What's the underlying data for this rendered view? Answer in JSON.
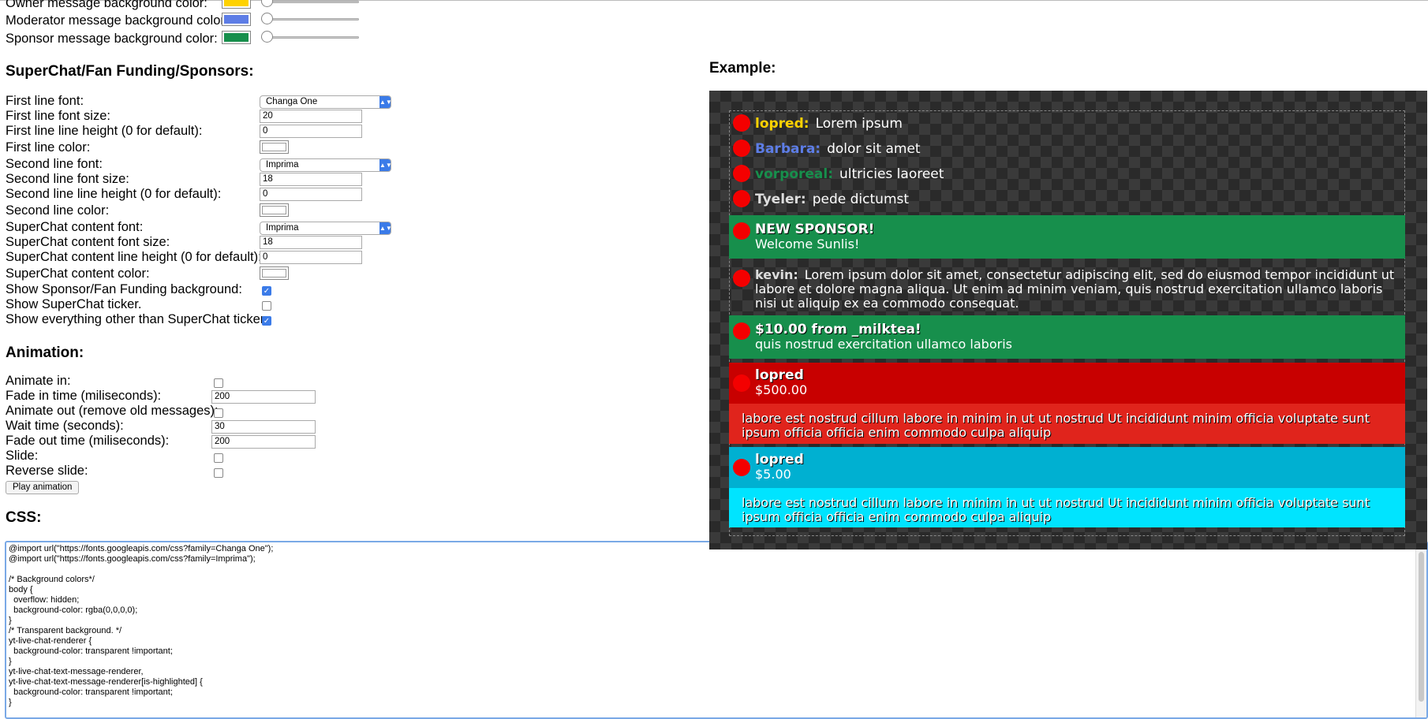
{
  "colors": {
    "owner_bg": "#ffd200",
    "moderator_bg": "#5d7de6",
    "sponsor_bg": "#178f4c",
    "accent": "#3b7be8",
    "superchat_red_head": "#c80000",
    "superchat_red_body": "#e0241c",
    "superchat_blue_head": "#00b0d1",
    "superchat_blue_body": "#00e4ff"
  },
  "top_settings": [
    {
      "label": "Owner message background color:",
      "color": "#ffd200"
    },
    {
      "label": "Moderator message background color:",
      "color": "#5d7de6"
    },
    {
      "label": "Sponsor message background color:",
      "color": "#178f4c"
    }
  ],
  "superchat_section": {
    "heading": "SuperChat/Fan Funding/Sponsors:",
    "first_line_font_label": "First line font:",
    "first_line_font_value": "Changa One",
    "first_line_font_size_label": "First line font size:",
    "first_line_font_size_value": "20",
    "first_line_line_height_label": "First line line height (0 for default):",
    "first_line_line_height_value": "0",
    "first_line_color_label": "First line color:",
    "second_line_font_label": "Second line font:",
    "second_line_font_value": "Imprima",
    "second_line_font_size_label": "Second line font size:",
    "second_line_font_size_value": "18",
    "second_line_line_height_label": "Second line line height (0 for default):",
    "second_line_line_height_value": "0",
    "second_line_color_label": "Second line color:",
    "content_font_label": "SuperChat content font:",
    "content_font_value": "Imprima",
    "content_font_size_label": "SuperChat content font size:",
    "content_font_size_value": "18",
    "content_line_height_label": "SuperChat content line height (0 for default):",
    "content_line_height_value": "0",
    "content_color_label": "SuperChat content color:",
    "show_bg_label": "Show Sponsor/Fan Funding background:",
    "show_bg_checked": true,
    "show_ticker_label": "Show SuperChat ticker.",
    "show_ticker_checked": false,
    "show_other_label": "Show everything other than SuperChat ticker.",
    "show_other_checked": true
  },
  "animation": {
    "heading": "Animation:",
    "animate_in_label": "Animate in:",
    "fade_in_label": "Fade in time (miliseconds):",
    "fade_in_value": "200",
    "animate_out_label": "Animate out (remove old messages):",
    "wait_label": "Wait time (seconds):",
    "wait_value": "30",
    "fade_out_label": "Fade out time (miliseconds):",
    "fade_out_value": "200",
    "slide_label": "Slide:",
    "reverse_slide_label": "Reverse slide:",
    "play_button": "Play animation"
  },
  "css_section": {
    "heading": "CSS:",
    "code": "@import url(\"https://fonts.googleapis.com/css?family=Changa One\");\n@import url(\"https://fonts.googleapis.com/css?family=Imprima\");\n\n/* Background colors*/\nbody {\n  overflow: hidden;\n  background-color: rgba(0,0,0,0);\n}\n/* Transparent background. */\nyt-live-chat-renderer {\n  background-color: transparent !important;\n}\nyt-live-chat-text-message-renderer,\nyt-live-chat-text-message-renderer[is-highlighted] {\n  background-color: transparent !important;\n}"
  },
  "example": {
    "heading": "Example:",
    "messages": [
      {
        "author": "lopred:",
        "text": "Lorem ipsum",
        "author_color": "#ffd200"
      },
      {
        "author": "Barbara:",
        "text": "dolor sit amet",
        "author_color": "#5d7de6"
      },
      {
        "author": "vorporeal:",
        "text": "ultricies laoreet",
        "author_color": "#178f4c"
      },
      {
        "author": "Tyeler:",
        "text": "pede dictumst",
        "author_color": "#dddddd"
      }
    ],
    "sponsor": {
      "title": "NEW SPONSOR!",
      "text": "Welcome Sunlis!"
    },
    "kevin": {
      "author": "kevin:",
      "text": "Lorem ipsum dolor sit amet, consectetur adipiscing elit, sed do eiusmod tempor incididunt ut labore et dolore magna aliqua. Ut enim ad minim veniam, quis nostrud exercitation ullamco laboris nisi ut aliquip ex ea commodo consequat."
    },
    "funding": {
      "title": "$10.00 from _milktea!",
      "text": "quis nostrud exercitation ullamco laboris"
    },
    "superchat1": {
      "author": "lopred",
      "amount": "$500.00",
      "text": "labore est nostrud cillum labore in minim in ut ut nostrud Ut incididunt minim officia voluptate sunt ipsum officia officia enim commodo culpa aliquip"
    },
    "superchat2": {
      "author": "lopred",
      "amount": "$5.00",
      "text": "labore est nostrud cillum labore in minim in ut ut nostrud Ut incididunt minim officia voluptate sunt ipsum officia officia enim commodo culpa aliquip"
    }
  }
}
